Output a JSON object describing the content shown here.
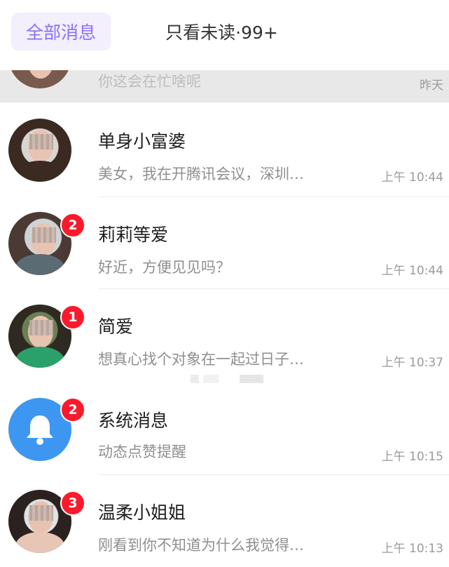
{
  "tabs": {
    "all": "全部消息",
    "unread": "只看未读·99+"
  },
  "pinned": {
    "preview": "你这会在忙啥呢",
    "time": "昨天"
  },
  "conversations": [
    {
      "name": "单身小富婆",
      "preview": "美女，我在开腾讯会议，深圳…",
      "time": "上午 10:44",
      "badge": ""
    },
    {
      "name": "莉莉等爱",
      "preview": "好近，方便见见吗？",
      "time": "上午 10:44",
      "badge": "2"
    },
    {
      "name": "简爱",
      "preview": "想真心找个对象在一起过日子…",
      "time": "上午 10:37",
      "badge": "1"
    },
    {
      "name": "系统消息",
      "preview": "动态点赞提醒",
      "time": "上午 10:15",
      "badge": "2",
      "icon": "bell-icon"
    },
    {
      "name": "温柔小姐姐",
      "preview": "刚看到你不知道为什么我觉得…",
      "time": "上午 10:13",
      "badge": "3"
    }
  ],
  "colors": {
    "accent": "#8c6ff2",
    "badge": "#fa1a2b",
    "system_avatar": "#3d97f0"
  }
}
